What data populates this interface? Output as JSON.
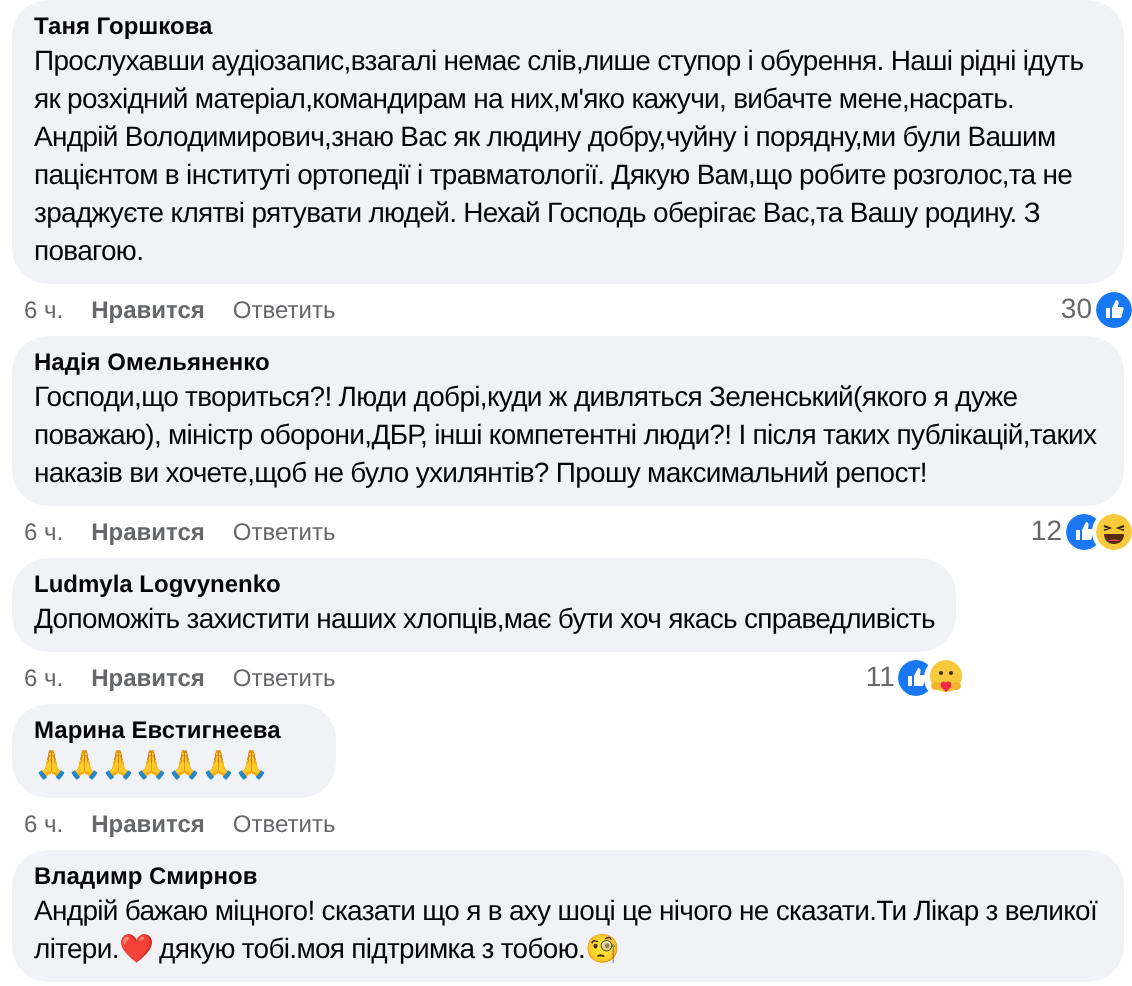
{
  "comments": [
    {
      "author": "Таня Горшкова",
      "text": "Прослухавши аудіозапис,взагалі немає слів,лише ступор і обурення. Наші рідні ідуть як розхідний матеріал,командирам на них,м'яко кажучи, вибачте мене,насрать. Андрій Володимирович,знаю Вас як людину добру,чуйну і порядну,ми були Вашим пацієнтом в інституті ортопедії і травматології. Дякую Вам,що робите розголос,та не зраджуєте клятві рятувати людей. Нехай Господь оберігає Вас,та Вашу родину. З повагою.",
      "time": "6 ч.",
      "like": "Нравится",
      "reply": "Ответить",
      "reaction_count": "30",
      "reactions": [
        {
          "kind": "like"
        }
      ]
    },
    {
      "author": "Надія Омельяненко",
      "text": "Господи,що твориться?! Люди добрі,куди ж дивляться Зеленський(якого я дуже поважаю), міністр оборони,ДБР, інші компетентні люди?! І після таких публікацій,таких наказів ви хочете,щоб не було ухилянтів? Прошу максимальний репост!",
      "time": "6 ч.",
      "like": "Нравится",
      "reply": "Ответить",
      "reaction_count": "12",
      "reactions": [
        {
          "kind": "like"
        },
        {
          "kind": "haha"
        }
      ]
    },
    {
      "author": "Ludmyla Logvynenko",
      "text": "Допоможіть захистити наших хлопців,має бути хоч якась справедливість",
      "time": "6 ч.",
      "like": "Нравится",
      "reply": "Ответить",
      "reaction_count": "11",
      "reactions": [
        {
          "kind": "like"
        },
        {
          "kind": "care"
        }
      ]
    },
    {
      "author": "Марина Евстигнеева",
      "text": "🙏🙏🙏🙏🙏🙏🙏",
      "time": "6 ч.",
      "like": "Нравится",
      "reply": "Ответить"
    },
    {
      "author": "Владимр Смирнов",
      "text": "Андрій бажаю міцного! сказати що я в аху шоці це нічого не сказати.Ти Лікар з великої літери.❤️ дякую тобі.моя підтримка з тобою.🧐"
    }
  ]
}
